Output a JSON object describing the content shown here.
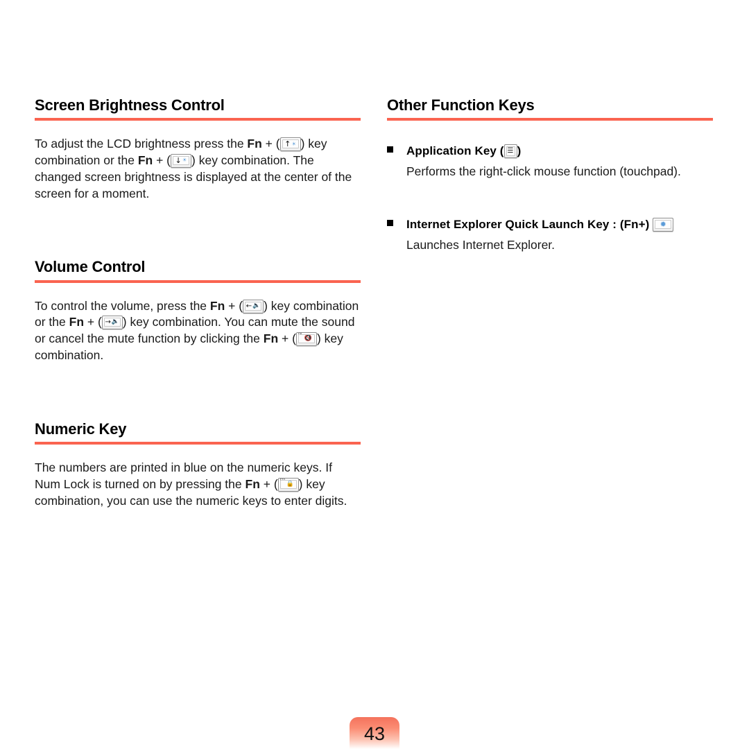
{
  "page": {
    "number": "43",
    "accent_color": "#fa6450",
    "background": "#ffffff"
  },
  "left_column": {
    "sections": [
      {
        "id": "screen-brightness-control",
        "title": "Screen Brightness Control",
        "body": {
          "t1": "To adjust the LCD brightness press the ",
          "fn1": "Fn",
          "plus1": " + (",
          "key1": {
            "name": "brightness-up-key",
            "arrow": "↑",
            "symbol": "☀",
            "label": ""
          },
          "t2": ") key combination or the ",
          "fn2": "Fn",
          "plus2": " + (",
          "key2": {
            "name": "brightness-down-key",
            "arrow": "↓",
            "symbol": "☀",
            "label": ""
          },
          "t3": ") key combination. The changed screen brightness is displayed at the center of the screen for a moment."
        }
      },
      {
        "id": "volume-control",
        "title": "Volume Control",
        "body": {
          "t1": "To control the volume, press the ",
          "fn1": "Fn",
          "plus1": " + (",
          "key1": {
            "name": "volume-down-key",
            "arrow": "←",
            "symbol": "🔈",
            "label": ""
          },
          "t2": ") key combination or the ",
          "fn2": "Fn",
          "plus2": " + (",
          "key2": {
            "name": "volume-up-key",
            "arrow": "→",
            "symbol": "🔈",
            "label": ""
          },
          "t3": ") key combination. You can mute the sound or cancel the mute function by clicking the ",
          "fn3": "Fn",
          "plus3": " + (",
          "key3": {
            "name": "mute-key",
            "arrow": "",
            "symbol": "🔇",
            "label": "F6"
          },
          "t4": ") key combination."
        }
      },
      {
        "id": "numeric-key",
        "title": "Numeric Key",
        "body": {
          "t1": "The numbers are printed in blue on the numeric keys. If Num Lock is turned on by pressing the ",
          "fn1": "Fn",
          "plus1": " + (",
          "key1": {
            "name": "num-lock-key",
            "arrow": "",
            "symbol": "🔒",
            "label": "F11"
          },
          "t2": ") key combination, you can use the numeric keys to enter digits."
        }
      }
    ]
  },
  "right_column": {
    "sections": [
      {
        "id": "other-function-keys",
        "title": "Other Function Keys",
        "bullets": [
          {
            "id": "application-key",
            "title_before": "Application Key (",
            "title_after": ")",
            "key": {
              "name": "application-key",
              "symbol": "☰",
              "label": ""
            },
            "description": "Performs the right-click mouse function (touchpad)."
          },
          {
            "id": "internet-explorer-quick-launch-key",
            "title_before": "Internet Explorer Quick Launch Key : (Fn+) ",
            "title_after": "",
            "key": {
              "name": "internet-explorer-key",
              "symbol": "✹",
              "label": ""
            },
            "description": "Launches Internet Explorer."
          }
        ]
      }
    ]
  }
}
